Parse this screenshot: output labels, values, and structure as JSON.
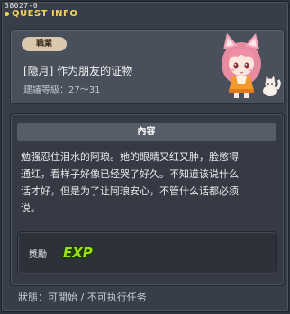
{
  "window": {
    "quest_id": "38027-0",
    "title": "QUEST INFO"
  },
  "header": {
    "job_badge": "職業",
    "quest_name": "[隐月] 作为朋友的证物",
    "level_range": "建議等級：27～31"
  },
  "content": {
    "section_title": "內容",
    "body_lines": [
      "勉强忍住泪水的阿琅。她的眼睛又红又肿，脸憋得",
      "通红，看样子好像已经哭了好久。不知道该说什么",
      "话才好，但是为了让阿琅安心，不管什么话都必须",
      "说。"
    ],
    "reward_label": "獎勵",
    "reward_icon": "exp-icon",
    "reward_icon_text": "EXP"
  },
  "status": {
    "text": "狀態：可開始 / 不可执行任务"
  },
  "colors": {
    "title": "#f2d25a",
    "exp_green": "#9be21a",
    "exp_yellow": "#f2d030"
  },
  "npc": {
    "icon": "fox-girl-npc-icon"
  }
}
